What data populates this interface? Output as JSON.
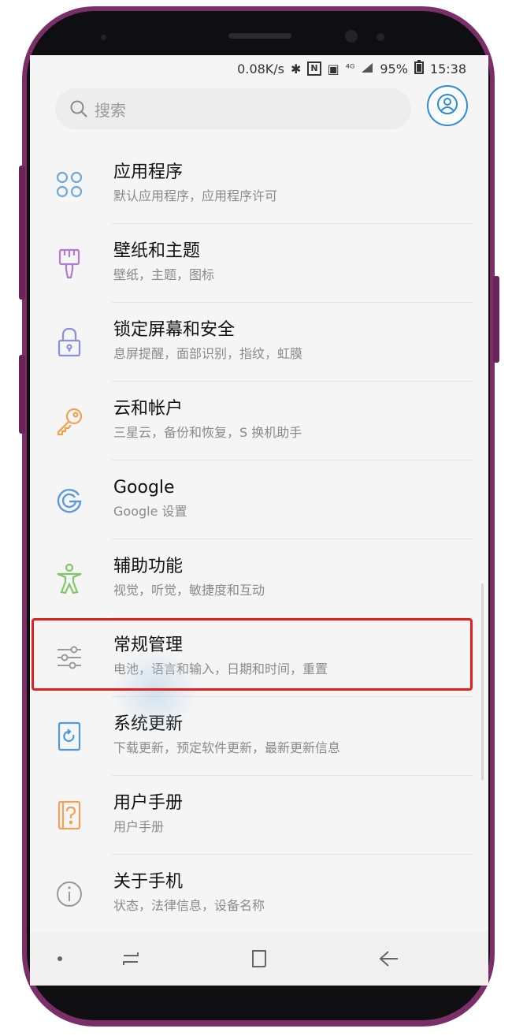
{
  "status_bar": {
    "network_speed": "0.08K/s",
    "battery": "95%",
    "time": "15:38",
    "bluetooth_glyph": "✱",
    "nfc_glyph": "N",
    "vibrate_glyph": "▣",
    "signal_glyph": "⁴ᴳ"
  },
  "search": {
    "placeholder": "搜索",
    "icon": "search-icon"
  },
  "profile": {
    "icon": "profile-icon",
    "accent": "#2d8bd6"
  },
  "settings_items": [
    {
      "title": "应用程序",
      "subtitle": "默认应用程序，应用程序许可",
      "icon": "apps-icon",
      "color": "#6fa7d8"
    },
    {
      "title": "壁纸和主题",
      "subtitle": "壁纸，主题，图标",
      "icon": "paint-brush-icon",
      "color": "#b07bd1"
    },
    {
      "title": "锁定屏幕和安全",
      "subtitle": "息屏提醒，面部识别，指纹，虹膜",
      "icon": "lock-icon",
      "color": "#8b8ed9"
    },
    {
      "title": "云和帐户",
      "subtitle": "三星云，备份和恢复，S 换机助手",
      "icon": "key-icon",
      "color": "#f0a257"
    },
    {
      "title": "Google",
      "subtitle": "Google 设置",
      "icon": "google-icon",
      "color": "#5c9ad6"
    },
    {
      "title": "辅助功能",
      "subtitle": "视觉，听觉，敏捷度和互动",
      "icon": "accessibility-icon",
      "color": "#83c56a"
    },
    {
      "title": "常规管理",
      "subtitle": "电池，语言和输入，日期和时间，重置",
      "icon": "sliders-icon",
      "color": "#9a9a9a"
    },
    {
      "title": "系统更新",
      "subtitle": "下载更新，预定软件更新，最新更新信息",
      "icon": "system-update-icon",
      "color": "#4e9ad8"
    },
    {
      "title": "用户手册",
      "subtitle": "用户手册",
      "icon": "manual-icon",
      "color": "#f0a257"
    },
    {
      "title": "关于手机",
      "subtitle": "状态，法律信息，设备名称",
      "icon": "info-icon",
      "color": "#9a9a9a"
    }
  ],
  "highlight": {
    "item": "常规管理",
    "color": "#e0201f"
  },
  "navigation": {
    "dot_icon": "dot-icon",
    "recents_icon": "recents-icon",
    "home_icon": "home-icon",
    "back_icon": "back-icon"
  }
}
